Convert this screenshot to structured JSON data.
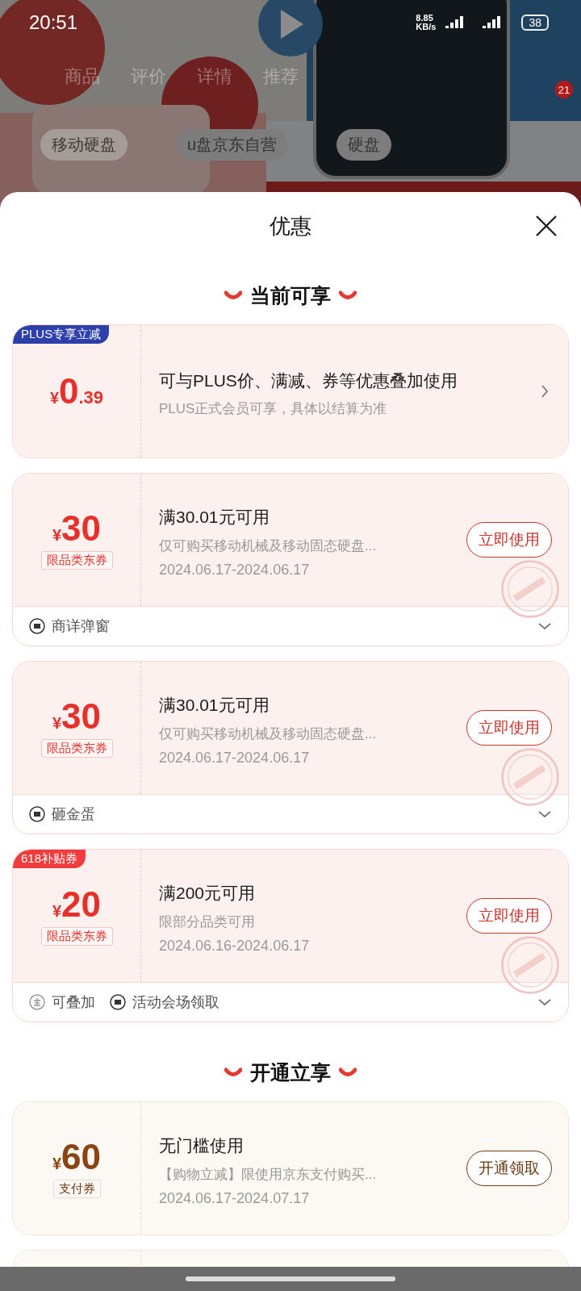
{
  "status_bar": {
    "time": "20:51",
    "speed_value": "8.85",
    "speed_unit": "KB/s",
    "battery": "38"
  },
  "background": {
    "tabs": [
      "商品",
      "评价",
      "详情",
      "推荐"
    ],
    "badge": "21",
    "chips": [
      "移动硬盘",
      "u盘京东自营",
      "硬盘"
    ]
  },
  "sheet": {
    "title": "优惠",
    "sections": [
      {
        "title": "当前可享",
        "coupons": [
          {
            "kind": "plus",
            "color": "#e8302a",
            "tag": {
              "text": "PLUS专享立减",
              "color": "#2d3fa8"
            },
            "currency": "¥",
            "amount": "0",
            "amount_decimal": ".39",
            "title": "可与PLUS价、满减、券等优惠叠加使用",
            "desc": "PLUS正式会员可享，具体以结算为准"
          },
          {
            "kind": "coupon",
            "color": "#e8302a",
            "currency": "¥",
            "amount": "30",
            "type_label": "限品类东券",
            "title": "满30.01元可用",
            "desc": "仅可购买移动机械及移动固态硬盘...",
            "date": "2024.06.17-2024.06.17",
            "action": "立即使用",
            "stamp": true,
            "footer": [
              {
                "kind": "ticket",
                "text": "商详弹窗"
              }
            ]
          },
          {
            "kind": "coupon",
            "color": "#e8302a",
            "currency": "¥",
            "amount": "30",
            "type_label": "限品类东券",
            "title": "满30.01元可用",
            "desc": "仅可购买移动机械及移动固态硬盘...",
            "date": "2024.06.17-2024.06.17",
            "action": "立即使用",
            "stamp": true,
            "footer": [
              {
                "kind": "ticket",
                "text": "砸金蛋"
              }
            ]
          },
          {
            "kind": "coupon",
            "color": "#e8302a",
            "tag": {
              "text": "618补贴券",
              "color": "#f03c3c"
            },
            "currency": "¥",
            "amount": "20",
            "type_label": "限品类东券",
            "title": "满200元可用",
            "desc": "限部分品类可用",
            "date": "2024.06.16-2024.06.17",
            "action": "立即使用",
            "stamp": true,
            "footer": [
              {
                "kind": "stack",
                "text": "可叠加"
              },
              {
                "kind": "ticket",
                "text": "活动会场领取"
              }
            ]
          }
        ]
      },
      {
        "title": "开通立享",
        "coupons": [
          {
            "kind": "coupon",
            "color": "#8a4512",
            "currency": "¥",
            "amount": "60",
            "type_label": "支付券",
            "title": "无门槛使用",
            "desc": "【购物立减】限使用京东支付购买...",
            "date": "2024.06.17-2024.07.17",
            "action": "开通领取",
            "stamp": false
          },
          {
            "kind": "partial"
          }
        ]
      }
    ]
  }
}
